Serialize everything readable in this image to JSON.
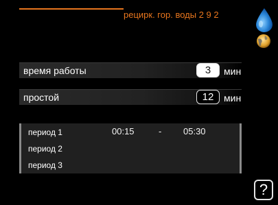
{
  "header": {
    "title": "рецирк. гор. воды 2 9 2",
    "accent_color": "#e8761e",
    "icons": [
      "water-drop-icon",
      "sun-icon"
    ]
  },
  "settings": [
    {
      "label": "время работы",
      "value": "3",
      "unit": "мин",
      "selected": true
    },
    {
      "label": "простой",
      "value": "12",
      "unit": "мин",
      "selected": false
    }
  ],
  "periods": [
    {
      "label": "период 1",
      "start": "00:15",
      "separator": "-",
      "end": "05:30"
    },
    {
      "label": "период 2",
      "start": "",
      "separator": "",
      "end": ""
    },
    {
      "label": "период 3",
      "start": "",
      "separator": "",
      "end": ""
    }
  ],
  "help": {
    "label": "?"
  }
}
